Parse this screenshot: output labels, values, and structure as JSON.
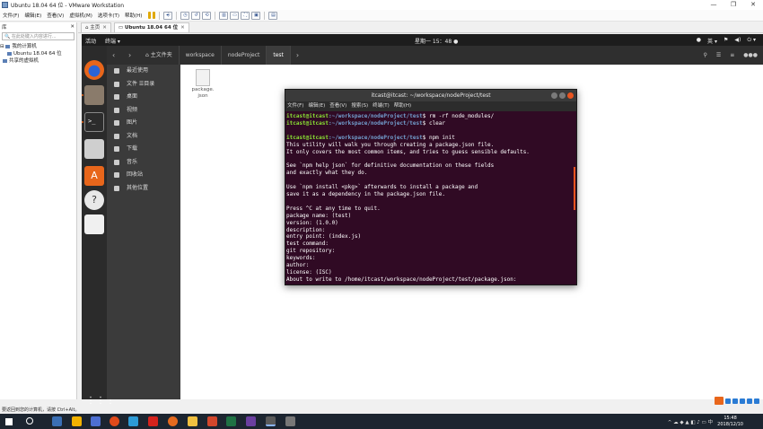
{
  "window": {
    "title": "Ubuntu 18.04 64 位 - VMware Workstation",
    "controls": [
      "—",
      "❐",
      "✕"
    ]
  },
  "menu": [
    "文件(F)",
    "编辑(E)",
    "查看(V)",
    "虚拟机(M)",
    "选项卡(T)",
    "帮助(H)"
  ],
  "library": {
    "header": "库",
    "close": "✕",
    "search_placeholder": "在此处键入内容进行...",
    "tree": [
      "我的计算机",
      "Ubuntu 18.04 64 位",
      "共享的虚拟机"
    ]
  },
  "tabs": [
    {
      "label": "主页"
    },
    {
      "label": "Ubuntu 18.04 64 位"
    }
  ],
  "gnome": {
    "activities": "活动",
    "app_menu": "终端 ▾",
    "clock": "星期一 15：48 ●",
    "tray": [
      "英 ▾",
      "⏻ ▾"
    ]
  },
  "nautilus": {
    "breadcrumbs": [
      "⌂ 主文件夹",
      "workspace",
      "nodeProject",
      "test"
    ],
    "sidebar": [
      "最近使用",
      "文件 ☰目录",
      "桌面",
      "视频",
      "图片",
      "文档",
      "下载",
      "音乐",
      "回收站",
      "其他位置"
    ],
    "files": [
      {
        "name": "package.\njson"
      }
    ]
  },
  "terminal": {
    "title": "itcast@itcast: ~/workspace/nodeProject/test",
    "menu": [
      "文件(F)",
      "编辑(E)",
      "查看(V)",
      "搜索(S)",
      "终端(T)",
      "帮助(H)"
    ],
    "prompt_user": "itcast@itcast",
    "prompt_path": ":~/workspace/nodeProject/test",
    "lines": [
      {
        "type": "cmd",
        "cmd": "$ rm -rf node_modules/"
      },
      {
        "type": "cmd",
        "cmd": "$ clear"
      },
      {
        "type": "out",
        "text": ""
      },
      {
        "type": "cmd",
        "cmd": "$ npm init"
      },
      {
        "type": "out",
        "text": "This utility will walk you through creating a package.json file."
      },
      {
        "type": "out",
        "text": "It only covers the most common items, and tries to guess sensible defaults."
      },
      {
        "type": "out",
        "text": ""
      },
      {
        "type": "out",
        "text": "See `npm help json` for definitive documentation on these fields"
      },
      {
        "type": "out",
        "text": "and exactly what they do."
      },
      {
        "type": "out",
        "text": ""
      },
      {
        "type": "out",
        "text": "Use `npm install <pkg>` afterwards to install a package and"
      },
      {
        "type": "out",
        "text": "save it as a dependency in the package.json file."
      },
      {
        "type": "out",
        "text": ""
      },
      {
        "type": "out",
        "text": "Press ^C at any time to quit."
      },
      {
        "type": "out",
        "text": "package name: (test)"
      },
      {
        "type": "out",
        "text": "version: (1.0.0)"
      },
      {
        "type": "out",
        "text": "description:"
      },
      {
        "type": "out",
        "text": "entry point: (index.js)"
      },
      {
        "type": "out",
        "text": "test command:"
      },
      {
        "type": "out",
        "text": "git repository:"
      },
      {
        "type": "out",
        "text": "keywords:"
      },
      {
        "type": "out",
        "text": "author:"
      },
      {
        "type": "out",
        "text": "license: (ISC)"
      },
      {
        "type": "out",
        "text": "About to write to /home/itcast/workspace/nodeProject/test/package.json:"
      }
    ]
  },
  "status_bar": "要返回到您的计算机，请按 Ctrl+Alt。",
  "taskbar": {
    "time": "15:48",
    "date": "2018/12/10",
    "lang": "中"
  },
  "colors": {
    "terminal_bg": "#300a24",
    "prompt_green": "#8ae234",
    "prompt_blue": "#729fcf",
    "ubuntu_orange": "#e95420"
  }
}
